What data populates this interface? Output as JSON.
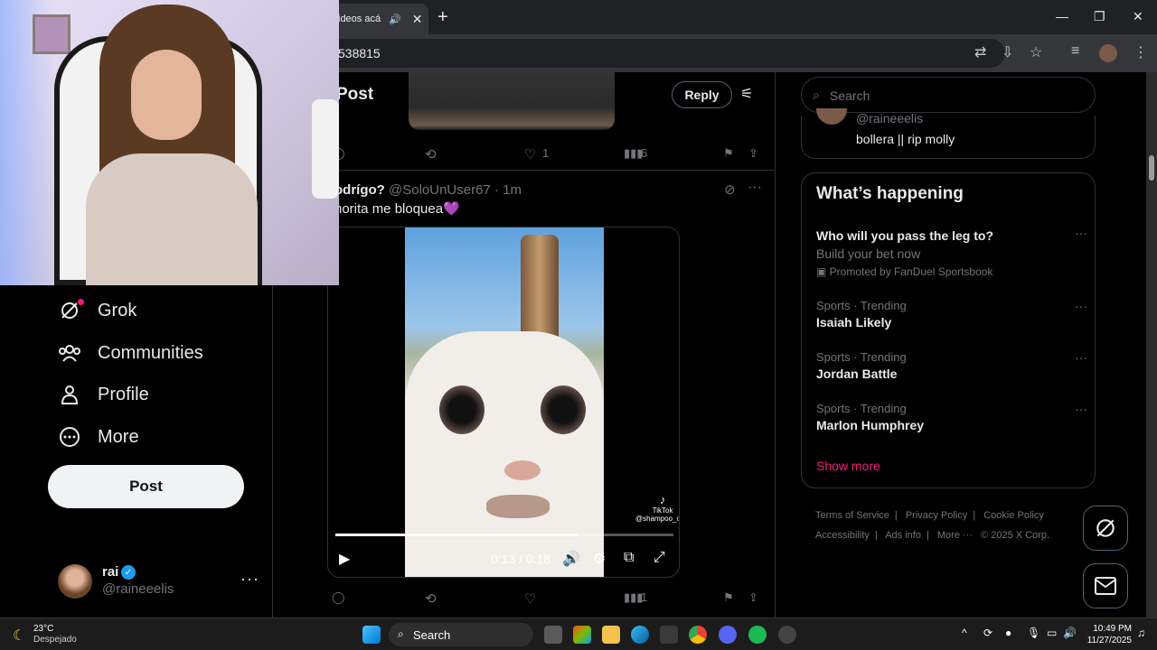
{
  "browser": {
    "tab_title": "ideos acá par",
    "url_partial": "538815"
  },
  "nav": {
    "items": [
      {
        "label": "Grok"
      },
      {
        "label": "Communities"
      },
      {
        "label": "Profile"
      },
      {
        "label": "More"
      }
    ],
    "post_label": "Post",
    "account": {
      "name": "rai",
      "handle": "@raineeelis"
    }
  },
  "main": {
    "title": "Post",
    "reply_label": "Reply",
    "first_actions": {
      "likes": "1",
      "views": "6"
    },
    "tweet": {
      "author": "odrígo?",
      "handle": "@SoloUnUser67",
      "time": "· 1m",
      "text": "horita me bloquea💜"
    },
    "video": {
      "time": "0:13 / 0:18",
      "progress": 0.72,
      "watermark_brand": "TikTok",
      "watermark_user": "@shampoo_owo"
    },
    "second_actions": {
      "views": "1"
    }
  },
  "right": {
    "search_placeholder": "Search",
    "who": {
      "handle": "@raineeelis",
      "bio": "bollera || rip molly"
    },
    "trends": {
      "heading": "What’s happening",
      "promo": {
        "title": "Who will you pass the leg to?",
        "subtitle": "Build your bet now",
        "promoted": "Promoted by FanDuel Sportsbook"
      },
      "items": [
        {
          "category": "Sports · Trending",
          "title": "Isaiah Likely"
        },
        {
          "category": "Sports · Trending",
          "title": "Jordan Battle"
        },
        {
          "category": "Sports · Trending",
          "title": "Marlon Humphrey"
        }
      ],
      "show_more": "Show more"
    },
    "footer": {
      "terms": "Terms of Service",
      "privacy": "Privacy Policy",
      "cookie": "Cookie Policy",
      "accessibility": "Accessibility",
      "ads": "Ads info",
      "more": "More ···",
      "copyright": "© 2025 X Corp."
    }
  },
  "taskbar": {
    "temp": "23°C",
    "condition": "Despejado",
    "search_label": "Search",
    "time": "10:49 PM",
    "date": "11/27/2025"
  },
  "colors": {
    "accent_pink": "#f91880",
    "verified_blue": "#1d9bf0",
    "border": "#2f3336",
    "muted_text": "#71767b"
  }
}
